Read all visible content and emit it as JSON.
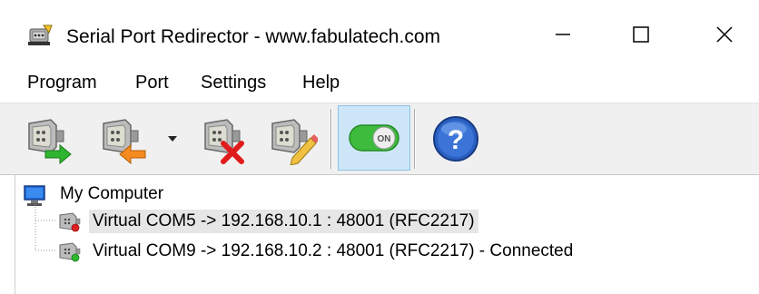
{
  "window": {
    "title": "Serial Port Redirector - www.fabulatech.com",
    "controls": {
      "minimize": "—",
      "maximize": "☐",
      "close": "✕"
    }
  },
  "menu": {
    "items": [
      {
        "label": "Program"
      },
      {
        "label": "Port"
      },
      {
        "label": "Settings"
      },
      {
        "label": "Help"
      }
    ]
  },
  "toolbar": {
    "buttons": [
      {
        "name": "add-port",
        "icon": "serial-connector-green-arrow-icon"
      },
      {
        "name": "add-port-options",
        "icon": "serial-connector-orange-arrow-icon"
      },
      {
        "name": "remove-port",
        "icon": "serial-connector-red-x-icon"
      },
      {
        "name": "edit-port",
        "icon": "serial-connector-pencil-icon"
      },
      {
        "name": "on-toggle",
        "icon": "toggle-on-icon"
      },
      {
        "name": "help",
        "icon": "help-question-icon"
      }
    ],
    "toggle_label": "ON",
    "help_glyph": "?"
  },
  "tree": {
    "root": {
      "label": "My Computer",
      "icon": "computer-icon"
    },
    "children": [
      {
        "label": "Virtual COM5 -> 192.168.10.1 : 48001 (RFC2217)",
        "status": "disconnected",
        "status_color": "#e02020"
      },
      {
        "label": "Virtual COM9 -> 192.168.10.2 : 48001 (RFC2217) - Connected",
        "status": "connected",
        "status_color": "#2eb82e"
      }
    ]
  },
  "colors": {
    "toolbar_bg": "#f0f0f0",
    "toggle_green": "#3dbb3d",
    "help_blue": "#2b5fc0",
    "selected_row": "#e6e6e6"
  }
}
